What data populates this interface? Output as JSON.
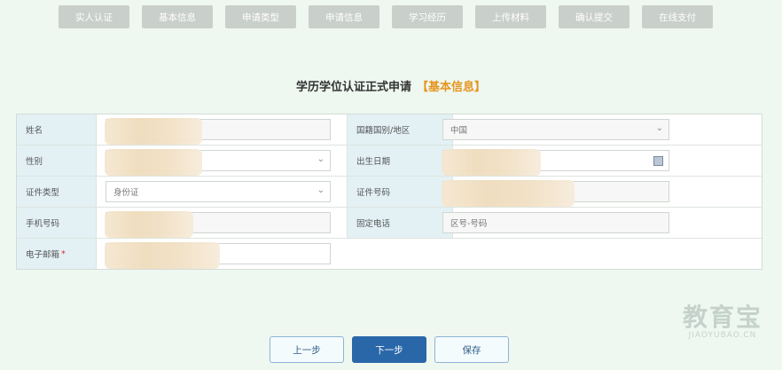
{
  "steps": [
    "实人认证",
    "基本信息",
    "申请类型",
    "申请信息",
    "学习经历",
    "上传材料",
    "确认提交",
    "在线支付"
  ],
  "title": "学历学位认证正式申请",
  "subtitle": "【基本信息】",
  "form": {
    "name_label": "姓名",
    "nationality_label": "国籍国别/地区",
    "nationality_value": "中国",
    "gender_label": "性别",
    "birthdate_label": "出生日期",
    "idtype_label": "证件类型",
    "idtype_value": "身份证",
    "idnumber_label": "证件号码",
    "phone_label": "手机号码",
    "landline_label": "固定电话",
    "landline_placeholder": "区号-号码",
    "email_label": "电子邮箱",
    "required_mark": "*"
  },
  "buttons": {
    "prev": "上一步",
    "next": "下一步",
    "save": "保存"
  },
  "watermark": {
    "main": "教育宝",
    "site": "JIAOYUBAO.CN"
  }
}
